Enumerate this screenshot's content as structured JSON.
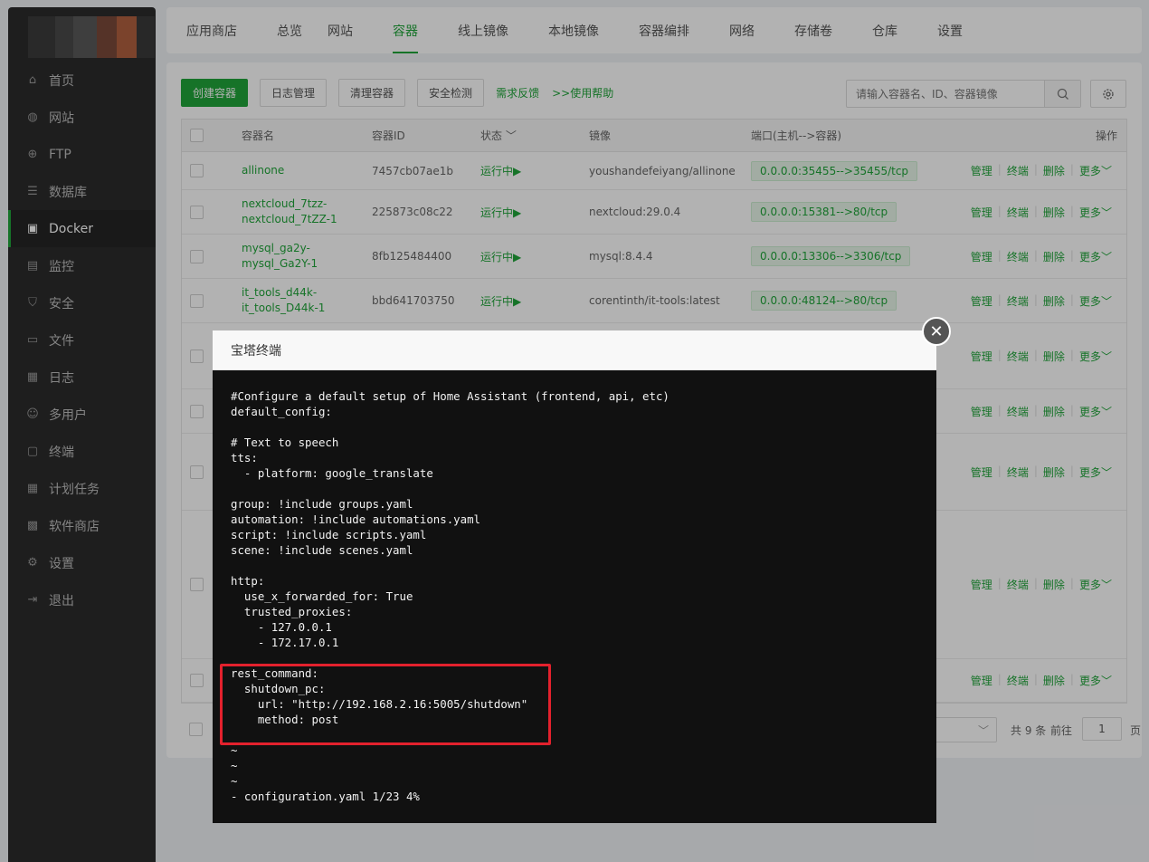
{
  "sidebar": {
    "logo_colors": [
      "#3c3c3c",
      "#4a4a4a",
      "#5a5a5a",
      "#7a4a3a",
      "#b06040",
      "#3a3a3a"
    ],
    "items": [
      {
        "label": "首页",
        "icon": "home-icon"
      },
      {
        "label": "网站",
        "icon": "globe-icon"
      },
      {
        "label": "FTP",
        "icon": "ftp-icon"
      },
      {
        "label": "数据库",
        "icon": "database-icon"
      },
      {
        "label": "Docker",
        "icon": "docker-icon",
        "active": true
      },
      {
        "label": "监控",
        "icon": "monitor-icon"
      },
      {
        "label": "安全",
        "icon": "shield-icon"
      },
      {
        "label": "文件",
        "icon": "folder-icon"
      },
      {
        "label": "日志",
        "icon": "log-icon"
      },
      {
        "label": "多用户",
        "icon": "users-icon"
      },
      {
        "label": "终端",
        "icon": "terminal-icon"
      },
      {
        "label": "计划任务",
        "icon": "calendar-icon"
      },
      {
        "label": "软件商店",
        "icon": "apps-icon"
      },
      {
        "label": "设置",
        "icon": "gear-icon"
      },
      {
        "label": "退出",
        "icon": "logout-icon"
      }
    ]
  },
  "tabs": [
    "应用商店",
    "总览",
    "网站",
    "容器",
    "线上镜像",
    "本地镜像",
    "容器编排",
    "网络",
    "存储卷",
    "仓库",
    "设置"
  ],
  "active_tab": "容器",
  "toolbar": {
    "create": "创建容器",
    "logs": "日志管理",
    "clean": "清理容器",
    "security": "安全检测",
    "feedback": "需求反馈",
    "help": ">>使用帮助",
    "search_placeholder": "请输入容器名、ID、容器镜像"
  },
  "table": {
    "headers": {
      "name": "容器名",
      "id": "容器ID",
      "status": "状态",
      "image": "镜像",
      "port": "端口(主机-->容器)",
      "ops": "操作"
    },
    "rows": [
      {
        "name": "allinone",
        "id": "7457cb07ae1b",
        "status": "运行中",
        "image": "youshandefeiyang/allinone",
        "port": "0.0.0.0:35455-->35455/tcp"
      },
      {
        "name": "nextcloud_7tzz-nextcloud_7tZZ-1",
        "id": "225873c08c22",
        "status": "运行中",
        "image": "nextcloud:29.0.4",
        "port": "0.0.0.0:15381-->80/tcp"
      },
      {
        "name": "mysql_ga2y-mysql_Ga2Y-1",
        "id": "8fb125484400",
        "status": "运行中",
        "image": "mysql:8.4.4",
        "port": "0.0.0.0:13306-->3306/tcp"
      },
      {
        "name": "it_tools_d44k-it_tools_D44k-1",
        "id": "bbd641703750",
        "status": "运行中",
        "image": "corentinth/it-tools:latest",
        "port": "0.0.0.0:48124-->80/tcp"
      },
      {
        "name": "",
        "id": "",
        "status": "",
        "image": "",
        "port": ""
      },
      {
        "name": "",
        "id": "",
        "status": "",
        "image": "",
        "port": ""
      },
      {
        "name": "",
        "id": "",
        "status": "",
        "image": "",
        "port": ""
      },
      {
        "name": "",
        "id": "",
        "status": "",
        "image": "",
        "port": ""
      },
      {
        "name": "",
        "id": "",
        "status": "",
        "image": "",
        "port": ""
      }
    ],
    "ops": {
      "manage": "管理",
      "terminal": "终端",
      "delete": "删除",
      "more": "更多"
    }
  },
  "pager": {
    "total": "共 9 条",
    "goto": "前往",
    "page_value": "1",
    "page_suffix": "页"
  },
  "modal": {
    "title": "宝塔终端",
    "lines": [
      "#Configure a default setup of Home Assistant (frontend, api, etc)",
      "default_config:",
      "",
      "# Text to speech",
      "tts:",
      "  - platform: google_translate",
      "",
      "group: !include groups.yaml",
      "automation: !include automations.yaml",
      "script: !include scripts.yaml",
      "scene: !include scenes.yaml",
      "",
      "http:",
      "  use_x_forwarded_for: True",
      "  trusted_proxies:",
      "    - 127.0.0.1",
      "    - 172.17.0.1",
      "",
      "rest_command:",
      "  shutdown_pc:",
      "    url: \"http://192.168.2.16:5005/shutdown\"",
      "    method: post",
      "",
      "~",
      "~",
      "~",
      "- configuration.yaml 1/23 4%"
    ]
  },
  "colors": {
    "accent": "#20a53a",
    "highlight": "#e3212d"
  }
}
